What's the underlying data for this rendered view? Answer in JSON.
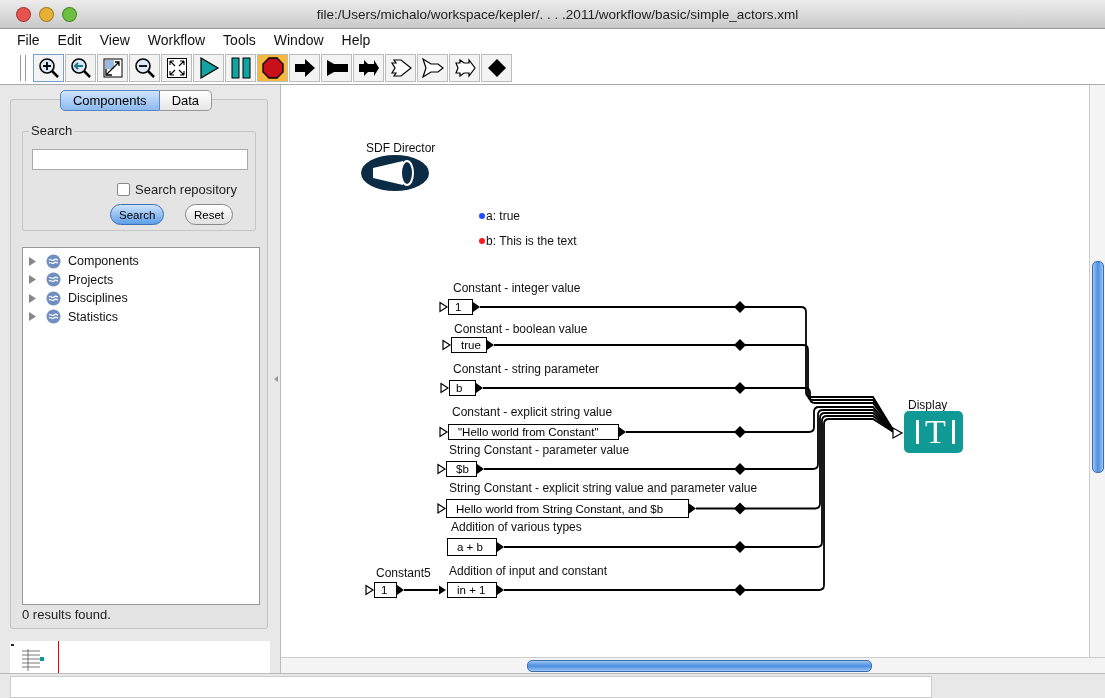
{
  "window": {
    "title": "file:/Users/michalo/workspace/kepler/. . . .2011/workflow/basic/simple_actors.xml"
  },
  "menu": [
    "File",
    "Edit",
    "View",
    "Workflow",
    "Tools",
    "Window",
    "Help"
  ],
  "toolbar": [
    {
      "kind": "zoom-in",
      "selected": false
    },
    {
      "kind": "zoom-reset",
      "selected": false
    },
    {
      "kind": "zoom-fit",
      "selected": false
    },
    {
      "kind": "zoom-out",
      "selected": false
    },
    {
      "kind": "full-screen",
      "selected": false
    },
    {
      "kind": "run",
      "selected": false
    },
    {
      "kind": "pause",
      "selected": false
    },
    {
      "kind": "stop",
      "selected": true
    },
    {
      "kind": "arrow",
      "selected": false
    },
    {
      "kind": "flag-arrow",
      "selected": false
    },
    {
      "kind": "notch-arrow",
      "selected": false
    },
    {
      "kind": "hollow-arrow",
      "selected": false
    },
    {
      "kind": "hollow-flag-arrow",
      "selected": false
    },
    {
      "kind": "hollow-notch-arrow",
      "selected": false
    },
    {
      "kind": "diamond",
      "selected": false
    }
  ],
  "sidebar": {
    "tabs": [
      {
        "label": "Components",
        "selected": true
      },
      {
        "label": "Data",
        "selected": false
      }
    ],
    "search": {
      "legend": "Search",
      "repository_label": "Search repository",
      "repository_checked": false,
      "buttons": [
        "Search",
        "Reset"
      ]
    },
    "tree": [
      {
        "label": "Components",
        "expanded": false
      },
      {
        "label": "Projects",
        "expanded": false
      },
      {
        "label": "Disciplines",
        "expanded": false
      },
      {
        "label": "Statistics",
        "expanded": false
      }
    ],
    "status": "0 results found."
  },
  "canvas": {
    "director": "SDF Director",
    "parameters": [
      {
        "text": "a: true",
        "color": "#1a4fff"
      },
      {
        "text": "b: This is the text",
        "color": "#ff1a1a"
      }
    ],
    "actors": [
      {
        "label": "Constant - integer value",
        "value": "1"
      },
      {
        "label": "Constant - boolean value",
        "value": "true"
      },
      {
        "label": "Constant - string parameter",
        "value": "b"
      },
      {
        "label": "Constant - explicit string value",
        "value": "\"Hello world from Constant\""
      },
      {
        "label": "String Constant - parameter value",
        "value": "$b"
      },
      {
        "label": "String Constant - explicit string value and parameter value",
        "value": "Hello world from String Constant, and $b"
      },
      {
        "label": "Addition of various types",
        "value": "a + b"
      },
      {
        "label": "Constant5",
        "value": "1"
      },
      {
        "label": "Addition of input and constant",
        "value": "in + 1"
      }
    ],
    "display": {
      "label": "Display",
      "glyph": "T"
    }
  }
}
